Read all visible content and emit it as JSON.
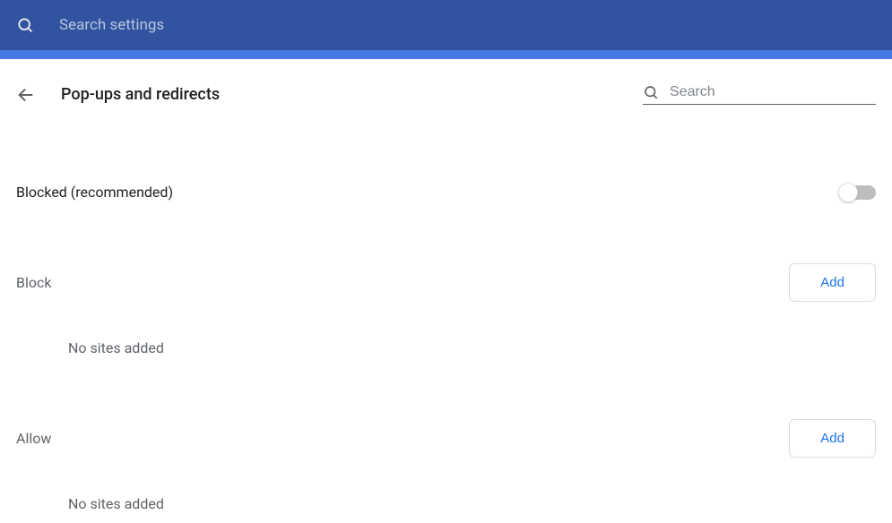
{
  "top_bar": {
    "search_placeholder": "Search settings"
  },
  "page": {
    "title": "Pop-ups and redirects",
    "search_placeholder": "Search"
  },
  "blocked_toggle": {
    "label": "Blocked (recommended)",
    "state": "off"
  },
  "sections": {
    "block": {
      "label": "Block",
      "add_button": "Add",
      "empty_text": "No sites added"
    },
    "allow": {
      "label": "Allow",
      "add_button": "Add",
      "empty_text": "No sites added"
    }
  }
}
